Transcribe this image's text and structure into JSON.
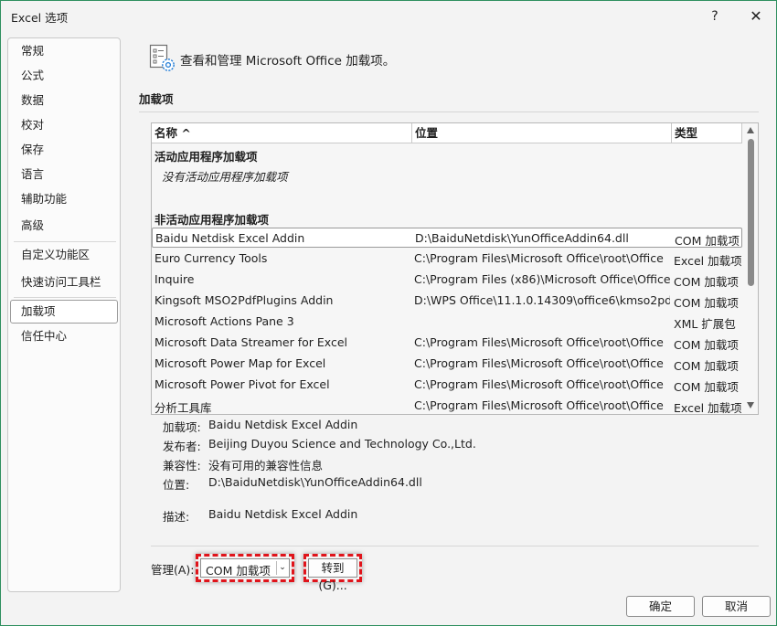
{
  "window": {
    "title": "Excel 选项",
    "help_label": "?",
    "close_label": "✕"
  },
  "sidebar": {
    "items": [
      {
        "label": "常规"
      },
      {
        "label": "公式"
      },
      {
        "label": "数据"
      },
      {
        "label": "校对"
      },
      {
        "label": "保存"
      },
      {
        "label": "语言"
      },
      {
        "label": "辅助功能"
      },
      {
        "label": "高级"
      },
      {
        "label": "自定义功能区"
      },
      {
        "label": "快速访问工具栏"
      },
      {
        "label": "加载项"
      },
      {
        "label": "信任中心"
      }
    ],
    "selected": "加载项"
  },
  "header": {
    "text": "查看和管理 Microsoft Office 加载项。",
    "icon": "addins-gear-icon"
  },
  "section": {
    "title": "加载项"
  },
  "table": {
    "columns": {
      "name": "名称 ^",
      "location": "位置",
      "type": "类型"
    },
    "active_group": "活动应用程序加载项",
    "active_empty": "没有活动应用程序加载项",
    "inactive_group": "非活动应用程序加载项",
    "rows": [
      {
        "name": "Baidu Netdisk Excel Addin",
        "location": "D:\\BaiduNetdisk\\YunOfficeAddin64.dll",
        "type": "COM 加载项"
      },
      {
        "name": "Euro Currency Tools",
        "location": "C:\\Program Files\\Microsoft Office\\root\\Office",
        "type": "Excel 加载项"
      },
      {
        "name": "Inquire",
        "location": "C:\\Program Files (x86)\\Microsoft Office\\Office",
        "type": "COM 加载项"
      },
      {
        "name": "Kingsoft MSO2PdfPlugins Addin",
        "location": "D:\\WPS Office\\11.1.0.14309\\office6\\kmso2pdf",
        "type": "COM 加载项"
      },
      {
        "name": "Microsoft Actions Pane 3",
        "location": "",
        "type": "XML 扩展包"
      },
      {
        "name": "Microsoft Data Streamer for Excel",
        "location": "C:\\Program Files\\Microsoft Office\\root\\Office",
        "type": "COM 加载项"
      },
      {
        "name": "Microsoft Power Map for Excel",
        "location": "C:\\Program Files\\Microsoft Office\\root\\Office",
        "type": "COM 加载项"
      },
      {
        "name": "Microsoft Power Pivot for Excel",
        "location": "C:\\Program Files\\Microsoft Office\\root\\Office",
        "type": "COM 加载项"
      },
      {
        "name": "分析工具库",
        "location": "C:\\Program Files\\Microsoft Office\\root\\Office",
        "type": "Excel 加载项"
      }
    ]
  },
  "details": {
    "addin_label": "加载项:",
    "addin_value": "Baidu Netdisk Excel Addin",
    "publisher_label": "发布者:",
    "publisher_value": "Beijing Duyou Science and Technology Co.,Ltd.",
    "compat_label": "兼容性:",
    "compat_value": "没有可用的兼容性信息",
    "location_label": "位置:",
    "location_value": "D:\\BaiduNetdisk\\YunOfficeAddin64.dll",
    "desc_label": "描述:",
    "desc_value": "Baidu Netdisk Excel Addin"
  },
  "manage": {
    "label": "管理(A):",
    "selected": "COM 加载项",
    "goto_label": "转到(G)..."
  },
  "footer": {
    "ok_label": "确定",
    "cancel_label": "取消"
  },
  "colors": {
    "highlight": "#e0141b",
    "window_border": "#2f8f5f",
    "icon_accent": "#1f7bd6"
  }
}
